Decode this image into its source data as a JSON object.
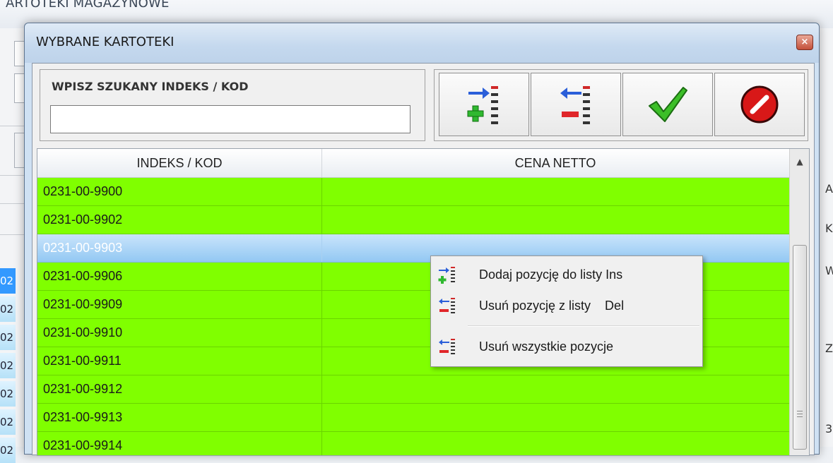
{
  "background_window": {
    "title": "ARTOTEKI MAGAZYNOWE",
    "left_rows": [
      "02",
      "02",
      "02",
      "02",
      "02",
      "02",
      "02"
    ],
    "right_chars": [
      "A",
      "K",
      "W",
      "Z",
      "3"
    ]
  },
  "dialog": {
    "title": "WYBRANE KARTOTEKI",
    "close_label": "×"
  },
  "search": {
    "label": "WPISZ SZUKANY INDEKS / KOD",
    "value": ""
  },
  "toolbar": {
    "buttons": [
      {
        "icon": "add-to-list-icon"
      },
      {
        "icon": "remove-from-list-icon"
      },
      {
        "icon": "confirm-check-icon"
      },
      {
        "icon": "cancel-icon"
      }
    ]
  },
  "grid": {
    "columns": [
      "INDEKS / KOD",
      "CENA NETTO"
    ],
    "rows": [
      {
        "code": "0231-00-9900",
        "price": ""
      },
      {
        "code": "0231-00-9902",
        "price": ""
      },
      {
        "code": "0231-00-9903",
        "price": "",
        "selected": true
      },
      {
        "code": "0231-00-9906",
        "price": ""
      },
      {
        "code": "0231-00-9909",
        "price": ""
      },
      {
        "code": "0231-00-9910",
        "price": ""
      },
      {
        "code": "0231-00-9911",
        "price": ""
      },
      {
        "code": "0231-00-9912",
        "price": ""
      },
      {
        "code": "0231-00-9913",
        "price": ""
      },
      {
        "code": "0231-00-9914",
        "price": ""
      }
    ],
    "row_color": "#80ff00",
    "selected_color": "#93c8f3"
  },
  "context_menu": {
    "items": [
      {
        "label": "Dodaj pozycję do listy Ins",
        "icon": "add-to-list-icon"
      },
      {
        "label": "Usuń pozycję z listy    Del",
        "icon": "remove-from-list-icon"
      },
      {
        "label": "Usuń wszystkie pozycje",
        "icon": "remove-all-icon"
      }
    ]
  }
}
